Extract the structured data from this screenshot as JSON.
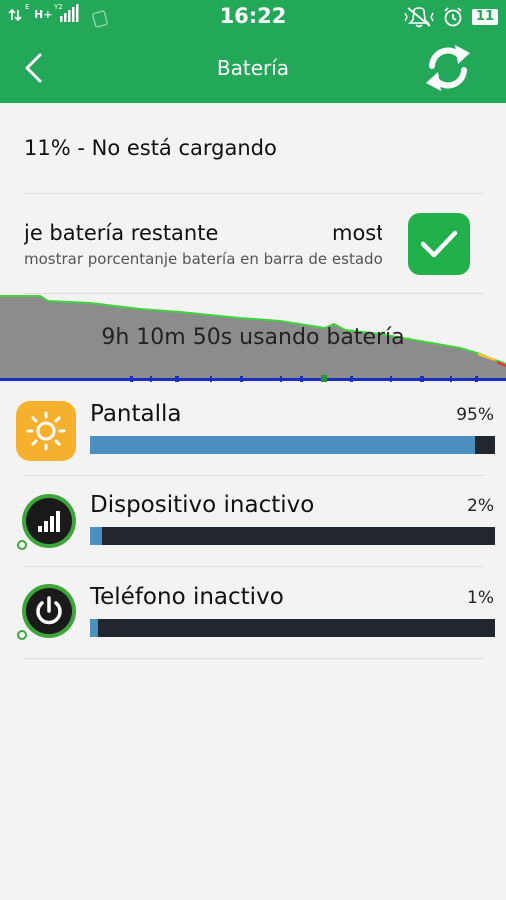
{
  "statusbar": {
    "time": "16:22",
    "network_label": "H+",
    "battery_level": "11"
  },
  "appbar": {
    "title": "Batería"
  },
  "status_text": "11% - No está cargando",
  "preference": {
    "title": "je batería restante",
    "title_tail": "most",
    "summary": "mostrar porcentanje batería en barra de estado",
    "checked": true
  },
  "graph": {
    "label": "9h 10m 50s usando batería"
  },
  "usage": [
    {
      "name": "Pantalla",
      "percent": "95%",
      "fraction": 0.95,
      "icon": "sun-icon"
    },
    {
      "name": "Dispositivo inactivo",
      "percent": "2%",
      "fraction": 0.03,
      "icon": "signal-icon"
    },
    {
      "name": "Teléfono inactivo",
      "percent": "1%",
      "fraction": 0.02,
      "icon": "power-icon"
    }
  ],
  "colors": {
    "accent": "#23a85a",
    "toggle": "#22b04a",
    "bar_fill": "#4a8fbe",
    "bar_track": "#22262e",
    "sun_bg": "#f5b12e"
  }
}
